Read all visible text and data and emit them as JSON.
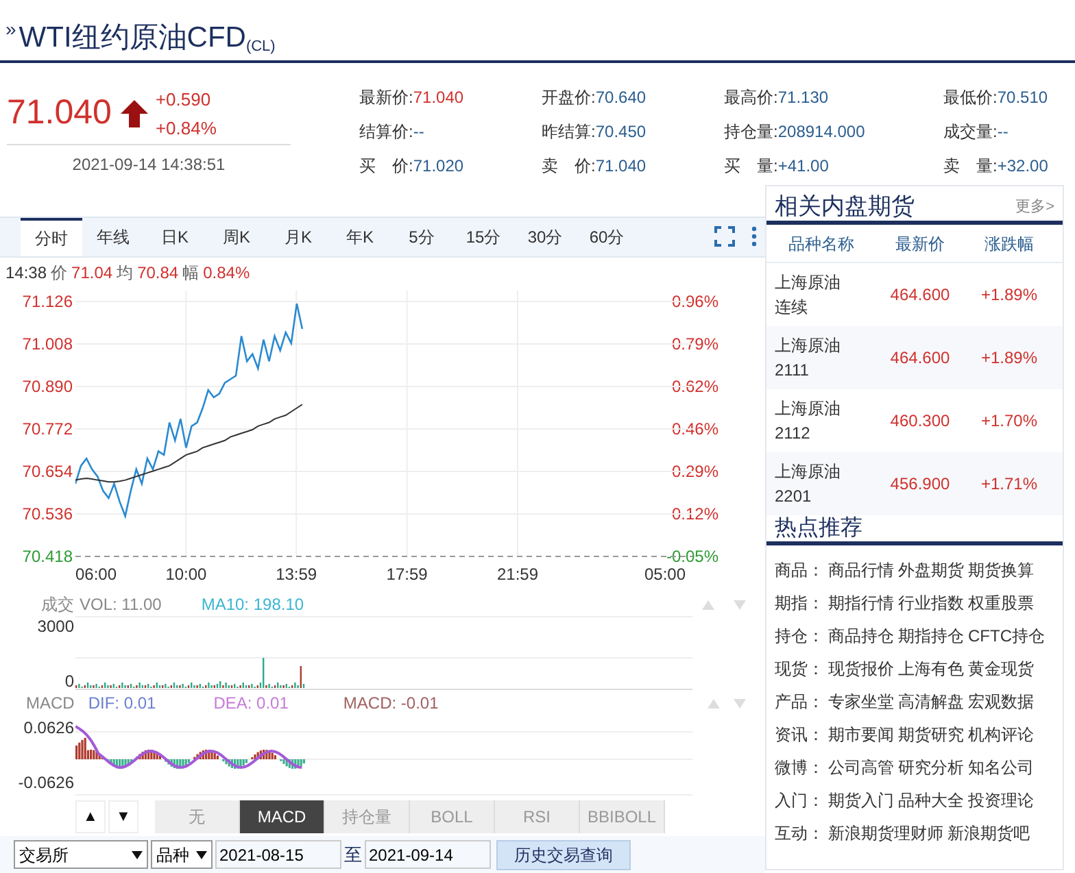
{
  "title": {
    "chevron": "»",
    "name": "WTI纽约原油CFD",
    "code": "(CL)"
  },
  "quote": {
    "price": "71.040",
    "rising": true,
    "change": "+0.590",
    "change_pct": "+0.84%",
    "timestamp": "2021-09-14 14:38:51"
  },
  "stats": [
    [
      {
        "label": "最新价:",
        "value": "71.040",
        "color": "#d0312d"
      },
      {
        "label": "开盘价:",
        "value": "70.640",
        "color": "#2a5d8f"
      },
      {
        "label": "最高价:",
        "value": "71.130",
        "color": "#2a5d8f"
      },
      {
        "label": "最低价:",
        "value": "70.510",
        "color": "#2a5d8f"
      }
    ],
    [
      {
        "label": "结算价:",
        "value": "--",
        "color": "#2a5d8f"
      },
      {
        "label": "昨结算:",
        "value": "70.450",
        "color": "#2a5d8f"
      },
      {
        "label": "持仓量:",
        "value": "208914.000",
        "color": "#2a5d8f"
      },
      {
        "label": "成交量:",
        "value": "--",
        "color": "#2a5d8f"
      }
    ],
    [
      {
        "label": "买　价:",
        "value": "71.020",
        "color": "#2a5d8f"
      },
      {
        "label": "卖　价:",
        "value": "71.040",
        "color": "#2a5d8f"
      },
      {
        "label": "买　量:",
        "value": "+41.00",
        "color": "#2a5d8f"
      },
      {
        "label": "卖　量:",
        "value": "+32.00",
        "color": "#2a5d8f"
      }
    ]
  ],
  "chart_tabs": [
    {
      "label": "分时",
      "selected": true
    },
    {
      "label": "年线",
      "selected": false
    },
    {
      "label": "日K",
      "selected": false
    },
    {
      "label": "周K",
      "selected": false
    },
    {
      "label": "月K",
      "selected": false
    },
    {
      "label": "年K",
      "selected": false
    },
    {
      "label": "5分",
      "selected": false
    },
    {
      "label": "15分",
      "selected": false
    },
    {
      "label": "30分",
      "selected": false
    },
    {
      "label": "60分",
      "selected": false
    }
  ],
  "info_line": {
    "time": "14:38",
    "price": "71.04",
    "avg": "70.84",
    "amp_label": "幅",
    "amp": "0.84%"
  },
  "price_chart": {
    "chart_data": {
      "type": "line",
      "x": [
        6,
        6.2,
        6.4,
        6.6,
        6.8,
        7,
        7.2,
        7.4,
        7.6,
        7.8,
        8,
        8.2,
        8.4,
        8.6,
        8.8,
        9,
        9.2,
        9.4,
        9.6,
        9.8,
        10,
        10.2,
        10.4,
        10.6,
        10.8,
        11,
        11.2,
        11.4,
        11.6,
        11.8,
        12,
        12.2,
        12.4,
        12.6,
        12.8,
        13,
        13.2,
        13.4,
        13.6,
        13.8,
        14,
        14.2
      ],
      "series": [
        {
          "name": "价",
          "color": "#2a8ad0",
          "values": [
            70.62,
            70.67,
            70.69,
            70.66,
            70.64,
            70.6,
            70.58,
            70.62,
            70.57,
            70.53,
            70.6,
            70.66,
            70.62,
            70.69,
            70.66,
            70.71,
            70.7,
            70.79,
            70.74,
            70.8,
            70.72,
            70.78,
            70.79,
            70.83,
            70.88,
            70.86,
            70.87,
            70.9,
            70.91,
            70.92,
            71.03,
            70.96,
            70.98,
            70.94,
            71.02,
            70.96,
            71.03,
            70.99,
            71.04,
            71.01,
            71.12,
            71.05
          ]
        },
        {
          "name": "均",
          "color": "#333333",
          "values": [
            70.63,
            70.633,
            70.635,
            70.633,
            70.63,
            70.628,
            70.625,
            70.625,
            70.627,
            70.63,
            70.635,
            70.64,
            70.645,
            70.65,
            70.655,
            70.66,
            70.665,
            70.67,
            70.68,
            70.69,
            70.7,
            70.705,
            70.71,
            70.72,
            70.725,
            70.73,
            70.735,
            70.74,
            70.75,
            70.755,
            70.76,
            70.765,
            70.77,
            70.78,
            70.785,
            70.79,
            70.8,
            70.805,
            70.81,
            70.82,
            70.83,
            70.84
          ]
        }
      ],
      "xlim": [
        6,
        28.3
      ],
      "ylim": [
        70.418,
        71.126
      ],
      "grid": true,
      "xticks": [
        {
          "value": 6,
          "label": "06:00"
        },
        {
          "value": 10,
          "label": "10:00"
        },
        {
          "value": 13.983,
          "label": "13:59"
        },
        {
          "value": 17.983,
          "label": "17:59"
        },
        {
          "value": 21.983,
          "label": "21:59"
        }
      ],
      "yticks": [
        {
          "value": 71.126,
          "label": "71.126"
        },
        {
          "value": 71.008,
          "label": "71.008"
        },
        {
          "value": 70.89,
          "label": "70.890"
        },
        {
          "value": 70.772,
          "label": "70.772"
        },
        {
          "value": 70.654,
          "label": "70.654"
        },
        {
          "value": 70.536,
          "label": "70.536"
        },
        {
          "value": 70.418,
          "label": "70.418"
        }
      ]
    },
    "time_axis_end": "05:00",
    "right_axis": [
      {
        "label": "0.96%",
        "color": "#d0312d"
      },
      {
        "label": "0.79%",
        "color": "#d0312d"
      },
      {
        "label": "0.62%",
        "color": "#d0312d"
      },
      {
        "label": "0.46%",
        "color": "#d0312d"
      },
      {
        "label": "0.29%",
        "color": "#d0312d"
      },
      {
        "label": "0.12%",
        "color": "#d0312d"
      },
      {
        "label": "-0.05%",
        "color": "#2e9a34"
      }
    ]
  },
  "volume": {
    "label": "成交",
    "vol": "VOL: 11.00",
    "ma10": "MA10: 198.10",
    "axis": [
      "3000",
      "0"
    ]
  },
  "macd": {
    "label": "MACD",
    "dif": "DIF: 0.01",
    "dea": "DEA: 0.01",
    "macd": "MACD: -0.01",
    "axis": [
      "0.0626",
      "-0.0626"
    ]
  },
  "nav_buttons": [
    "▲",
    "▼"
  ],
  "indicator_tabs": [
    {
      "label": "无",
      "selected": false
    },
    {
      "label": "MACD",
      "selected": true
    },
    {
      "label": "持仓量",
      "selected": false
    },
    {
      "label": "BOLL",
      "selected": false
    },
    {
      "label": "RSI",
      "selected": false
    },
    {
      "label": "BBIBOLL",
      "selected": false
    }
  ],
  "query": {
    "exchange": "交易所",
    "variety": "品种",
    "start": "2021-08-15",
    "separator": "至",
    "end": "2021-09-14",
    "button": "历史交易查询"
  },
  "related": {
    "title": "相关内盘期货",
    "more": "更多>",
    "columns": [
      "品种名称",
      "最新价",
      "涨跌幅"
    ],
    "rows": [
      {
        "name": "上海原油连续",
        "price": "464.600",
        "change": "+1.89%"
      },
      {
        "name": "上海原油2111",
        "price": "464.600",
        "change": "+1.89%"
      },
      {
        "name": "上海原油2112",
        "price": "460.300",
        "change": "+1.70%"
      },
      {
        "name": "上海原油2201",
        "price": "456.900",
        "change": "+1.71%"
      }
    ]
  },
  "hot": {
    "title": "热点推荐",
    "separator": "：",
    "rows": [
      {
        "category": "商品",
        "links": [
          "商品行情",
          "外盘期货",
          "期货换算"
        ]
      },
      {
        "category": "期指",
        "links": [
          "期指行情",
          "行业指数",
          "权重股票"
        ]
      },
      {
        "category": "持仓",
        "links": [
          "商品持仓",
          "期指持仓",
          "CFTC持仓"
        ]
      },
      {
        "category": "现货",
        "links": [
          "现货报价",
          "上海有色",
          "黄金现货"
        ]
      },
      {
        "category": "产品",
        "links": [
          "专家坐堂",
          "高清解盘",
          "宏观数据"
        ]
      },
      {
        "category": "资讯",
        "links": [
          "期市要闻",
          "期货研究",
          "机构评论"
        ]
      },
      {
        "category": "微博",
        "links": [
          "公司高管",
          "研究分析",
          "知名公司"
        ]
      },
      {
        "category": "入门",
        "links": [
          "期货入门",
          "品种大全",
          "投资理论"
        ]
      },
      {
        "category": "互动",
        "links": [
          "新浪期货理财师",
          "新浪期货吧"
        ]
      }
    ]
  }
}
